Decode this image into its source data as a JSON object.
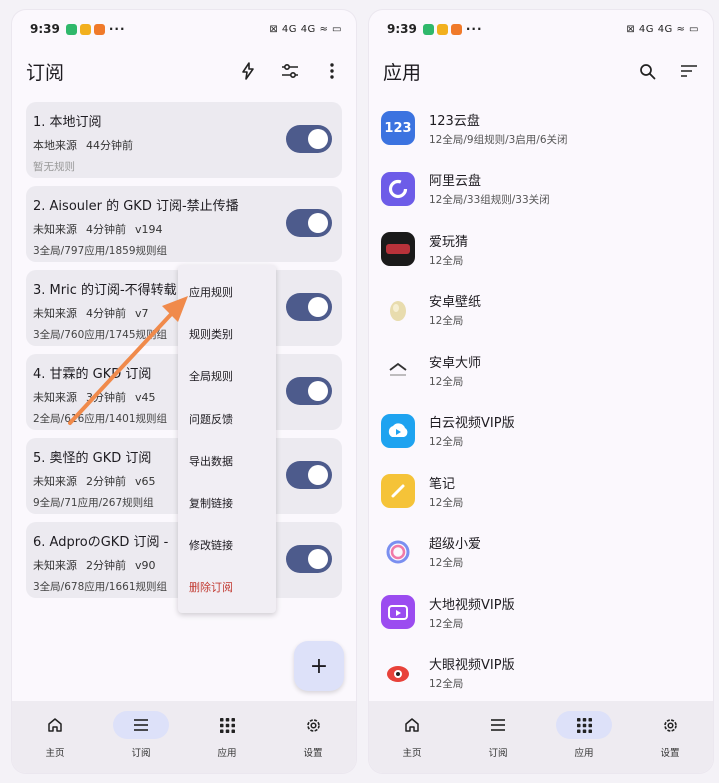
{
  "left": {
    "status": {
      "time": "9:39",
      "more": "···",
      "right": "⊠ 4G 4G ≈ ▭"
    },
    "appbar": {
      "title": "订阅"
    },
    "subscriptions": [
      {
        "title": "1. 本地订阅",
        "source": "本地来源",
        "time": "44分钟前",
        "version": "",
        "stats": "暂无规则",
        "enabled": true
      },
      {
        "title": "2. Aisouler 的 GKD 订阅-禁止传播",
        "source": "未知来源",
        "time": "4分钟前",
        "version": "v194",
        "stats": "3全局/797应用/1859规则组",
        "enabled": true
      },
      {
        "title": "3. Mric 的订阅-不得转载",
        "source": "未知来源",
        "time": "4分钟前",
        "version": "v7",
        "stats": "3全局/760应用/1745规则组",
        "enabled": true
      },
      {
        "title": "4. 甘霖的 GKD 订阅",
        "source": "未知来源",
        "time": "3分钟前",
        "version": "v45",
        "stats": "2全局/616应用/1401规则组",
        "enabled": true
      },
      {
        "title": "5. 奥怪的 GKD 订阅",
        "source": "未知来源",
        "time": "2分钟前",
        "version": "v65",
        "stats": "9全局/71应用/267规则组",
        "enabled": true
      },
      {
        "title": "6. AdproのGKD 订阅 -",
        "source": "未知来源",
        "time": "2分钟前",
        "version": "v90",
        "stats": "3全局/678应用/1661规则组",
        "enabled": true
      }
    ],
    "menu": [
      "应用规则",
      "规则类别",
      "全局规则",
      "问题反馈",
      "导出数据",
      "复制链接",
      "修改链接",
      "删除订阅"
    ],
    "fab_label": "+",
    "nav": [
      {
        "label": "主页",
        "icon": "home-icon"
      },
      {
        "label": "订阅",
        "icon": "list-icon",
        "active": true
      },
      {
        "label": "应用",
        "icon": "apps-icon"
      },
      {
        "label": "设置",
        "icon": "settings-icon"
      }
    ]
  },
  "right": {
    "status": {
      "time": "9:39",
      "more": "···",
      "right": "⊠ 4G 4G ≈ ▭"
    },
    "appbar": {
      "title": "应用"
    },
    "apps": [
      {
        "name": "123云盘",
        "sub": "12全局/9组规则/3启用/6关闭",
        "icon_text": "123",
        "color": "#3b73e0"
      },
      {
        "name": "阿里云盘",
        "sub": "12全局/33组规则/33关闭",
        "icon_text": "",
        "color": "#6d5ce8"
      },
      {
        "name": "爱玩猜",
        "sub": "12全局",
        "icon_text": "",
        "color": "#1a1a1a"
      },
      {
        "name": "安卓壁纸",
        "sub": "12全局",
        "icon_text": "",
        "color": "#f3ecd7"
      },
      {
        "name": "安卓大师",
        "sub": "12全局",
        "icon_text": "",
        "color": "#f7f7f7"
      },
      {
        "name": "白云视频VIP版",
        "sub": "12全局",
        "icon_text": "",
        "color": "#1ea3f0"
      },
      {
        "name": "笔记",
        "sub": "12全局",
        "icon_text": "",
        "color": "#f5c338"
      },
      {
        "name": "超级小爱",
        "sub": "12全局",
        "icon_text": "",
        "color": "#f3eef5"
      },
      {
        "name": "大地视频VIP版",
        "sub": "12全局",
        "icon_text": "",
        "color": "#9b4cf0"
      },
      {
        "name": "大眼视频VIP版",
        "sub": "12全局",
        "icon_text": "",
        "color": "#fbeaea"
      }
    ],
    "nav": [
      {
        "label": "主页",
        "icon": "home-icon"
      },
      {
        "label": "订阅",
        "icon": "list-icon"
      },
      {
        "label": "应用",
        "icon": "apps-icon",
        "active": true
      },
      {
        "label": "设置",
        "icon": "settings-icon"
      }
    ]
  },
  "colors": {
    "toggle_on": "#4d5b8c",
    "accent_container": "#dde1f9",
    "danger": "#c23b32",
    "arrow": "#f08a4b"
  }
}
